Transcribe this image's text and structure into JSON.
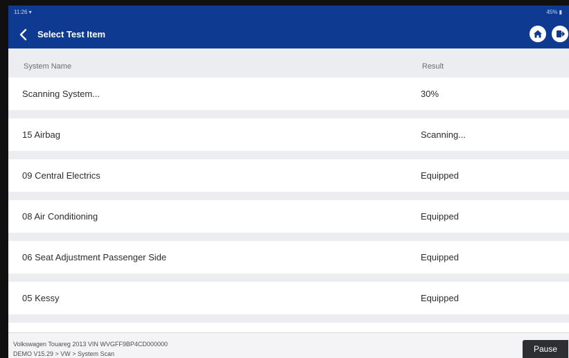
{
  "status_bar": {
    "time": "11:26 ▾",
    "battery": "45% ▮"
  },
  "header": {
    "title": "Select Test Item"
  },
  "table": {
    "columns": {
      "name": "System Name",
      "result": "Result"
    },
    "rows": [
      {
        "name": "Scanning System...",
        "result": "30%"
      },
      {
        "name": "15 Airbag",
        "result": "Scanning..."
      },
      {
        "name": "09 Central Electrics",
        "result": "Equipped"
      },
      {
        "name": "08 Air Conditioning",
        "result": "Equipped"
      },
      {
        "name": "06 Seat Adjustment Passenger Side",
        "result": "Equipped"
      },
      {
        "name": "05 Kessy",
        "result": "Equipped"
      }
    ]
  },
  "footer": {
    "vehicle_info": "Volkswagen  Touareg  2013  VIN  WVGFF9BP4CD000000",
    "path": "DEMO V15.29 > VW > System Scan",
    "pause_label": "Pause"
  },
  "colors": {
    "header_bg": "#0e3a91",
    "page_bg": "#ecedf0",
    "pause_bg": "#2e2f33"
  }
}
